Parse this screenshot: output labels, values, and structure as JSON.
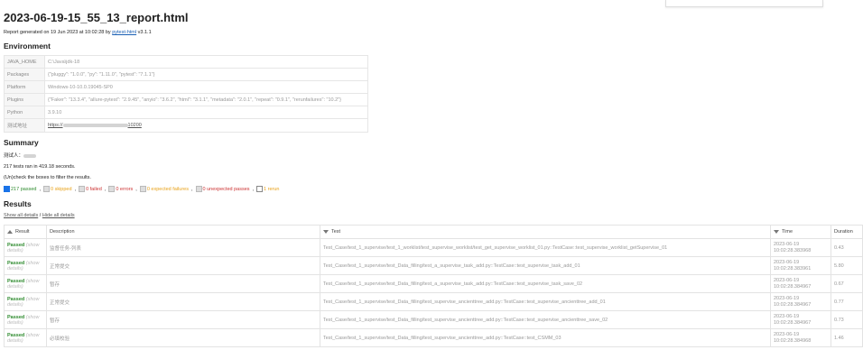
{
  "title": "2023-06-19-15_55_13_report.html",
  "generated": {
    "prefix": "Report generated on",
    "date": "19 Jun 2023 at 10:02:28",
    "by": "by",
    "tool": "pytest-html",
    "version": "v3.1.1"
  },
  "environment": {
    "heading": "Environment",
    "rows": [
      {
        "key": "JAVA_HOME",
        "value": "C:\\Java\\jdk-18"
      },
      {
        "key": "Packages",
        "value": "{\"pluggy\": \"1.0.0\", \"py\": \"1.11.0\", \"pytest\": \"7.1.1\"}"
      },
      {
        "key": "Platform",
        "value": "Windows-10-10.0.19045-SP0"
      },
      {
        "key": "Plugins",
        "value": "{\"Faker\": \"13.3.4\", \"allure-pytest\": \"2.9.45\", \"anyio\": \"3.6.2\", \"html\": \"3.1.1\", \"metadata\": \"2.0.1\", \"repeat\": \"0.9.1\", \"rerunfailures\": \"10.2\"}"
      },
      {
        "key": "Python",
        "value": "3.9.10"
      },
      {
        "key": "测试地址",
        "value_prefix": "https://",
        "value_suffix": "10200"
      }
    ]
  },
  "summary": {
    "heading": "Summary",
    "tester": "测试人：",
    "count_line": "217 tests ran in 419.18 seconds.",
    "hint": "(Un)check the boxes to filter the results.",
    "filters": [
      {
        "label": "217 passed",
        "cls": "passed",
        "checked": true
      },
      {
        "label": "0 skipped",
        "cls": "skipped",
        "checked": false
      },
      {
        "label": "0 failed",
        "cls": "failed",
        "checked": false
      },
      {
        "label": "0 errors",
        "cls": "errors",
        "checked": false
      },
      {
        "label": "0 expected failures",
        "cls": "xfailed",
        "checked": false
      },
      {
        "label": "0 unexpected passes",
        "cls": "xpassed",
        "checked": false
      },
      {
        "label": "1 rerun",
        "cls": "rerun",
        "checked": false
      }
    ]
  },
  "results": {
    "heading": "Results",
    "show_all": "Show all details",
    "hide_all": "Hide all details",
    "columns": {
      "result": "Result",
      "description": "Description",
      "test": "Test",
      "time": "Time",
      "duration": "Duration"
    },
    "show_label": "(show",
    "details_label": "details)",
    "rows": [
      {
        "result": "Passed",
        "description": "监督任务-列表",
        "test": "Test_Case/test_1_supervise/test_1_worklist/test_supervise_worklist/test_get_supervise_worklist_01.py::TestCase::test_supervise_worklist_getSupervise_01",
        "time_date": "2023-06-19",
        "time_clock": "10:02:28.383968",
        "duration": "0.43"
      },
      {
        "result": "Passed",
        "description": "正常提交",
        "test": "Test_Case/test_1_supervise/test_Data_filling/test_a_supervise_task_add.py::TestCase::test_supervise_task_add_01",
        "time_date": "2023-06-19",
        "time_clock": "10:02:28.383961",
        "duration": "5.80"
      },
      {
        "result": "Passed",
        "description": "暂存",
        "test": "Test_Case/test_1_supervise/test_Data_filling/test_a_supervise_task_add.py::TestCase::test_supervise_task_save_02",
        "time_date": "2023-06-19",
        "time_clock": "10:02:28.384967",
        "duration": "0.67"
      },
      {
        "result": "Passed",
        "description": "正常提交",
        "test": "Test_Case/test_1_supervise/test_Data_filling/test_supervise_ancienttree_add.py::TestCase::test_supervise_ancienttree_add_01",
        "time_date": "2023-06-19",
        "time_clock": "10:02:28.384967",
        "duration": "0.77"
      },
      {
        "result": "Passed",
        "description": "暂存",
        "test": "Test_Case/test_1_supervise/test_Data_filling/test_supervise_ancienttree_add.py::TestCase::test_supervise_ancienttree_save_02",
        "time_date": "2023-06-19",
        "time_clock": "10:02:28.384967",
        "duration": "0.73"
      },
      {
        "result": "Passed",
        "description": "必填校验",
        "test": "Test_Case/test_1_supervise/test_Data_filling/test_supervise_ancienttree_add.py::TestCase::test_CSMM_03",
        "time_date": "2023-06-19",
        "time_clock": "10:02:28.384968",
        "duration": "1.46"
      }
    ]
  }
}
